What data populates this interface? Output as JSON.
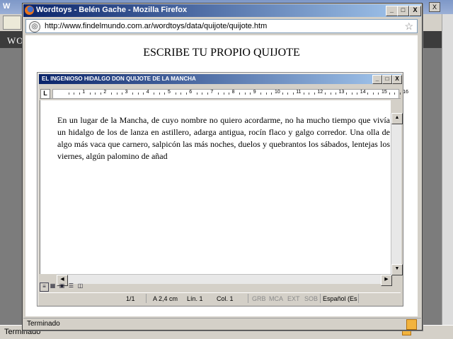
{
  "background_window": {
    "title": "W",
    "site_header": "WO",
    "status": "Terminado"
  },
  "popup": {
    "title": "Wordtoys - Belén Gache - Mozilla Firefox",
    "url": "http://www.findelmundo.com.ar/wordtoys/data/quijote/quijote.htm",
    "status": "Terminado"
  },
  "page": {
    "heading": "ESCRIBE TU PROPIO QUIJOTE"
  },
  "editor": {
    "title": "EL INGENIOSO HIDALGO DON QUIJOTE DE LA MANCHA",
    "ruler_tab": "L",
    "ruler_numbers": [
      "1",
      "2",
      "3",
      "4",
      "5",
      "6",
      "7",
      "8",
      "9",
      "10",
      "11",
      "12",
      "13",
      "14",
      "15",
      "16"
    ],
    "text": "En un lugar de la Mancha, de cuyo nombre no quiero acordarme, no ha mucho tiempo que vivía un hidalgo de los de lanza en astillero, adarga antigua, rocín flaco y galgo corredor. Una olla de algo más vaca que carnero, salpicón las más noches, duelos y quebrantos los sábados, lentejas los viernes, algún palomino de añad",
    "status": {
      "page": "1/1",
      "position": "A  2,4 cm",
      "line": "Lín.  1",
      "column": "Col.  1",
      "grb": "GRB",
      "mca": "MCA",
      "ext": "EXT",
      "sob": "SOB",
      "language": "Español (Es"
    }
  },
  "controls": {
    "minimize": "_",
    "maximize": "□",
    "close": "X"
  }
}
